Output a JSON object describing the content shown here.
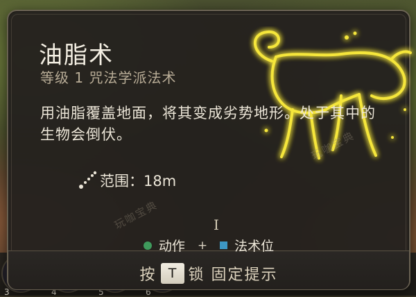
{
  "spell": {
    "name": "油脂术",
    "subtitle": "等级 1 咒法学派法术",
    "description": "用油脂覆盖地面，将其变成劣势地形。处于其中的生物会倒伏。",
    "range_label": "范围：18m"
  },
  "cost": {
    "action_label": "动作",
    "plus": "+",
    "spell_slot_label": "法术位"
  },
  "hint": {
    "before": "按",
    "key": "T",
    "after": "锁 固定提示"
  },
  "cursor_glyph": "I",
  "watermarks": [
    "玩咖宝典",
    "玩咖宝典"
  ],
  "hotbar": {
    "slot_numbers": [
      "3",
      "4",
      "5",
      "6"
    ]
  },
  "icons": {
    "emblem": "grease-splatter-emblem-icon",
    "range": "range-icon",
    "action": "action-dot-icon",
    "spell_slot": "spell-slot-square-icon"
  },
  "colors": {
    "emblem_glow": "#f5e63a",
    "action_dot": "#3f9a5c",
    "spell_slot_square": "#3d97c4",
    "title_text": "#f4efe3",
    "subtitle_text": "#b9ad97"
  }
}
